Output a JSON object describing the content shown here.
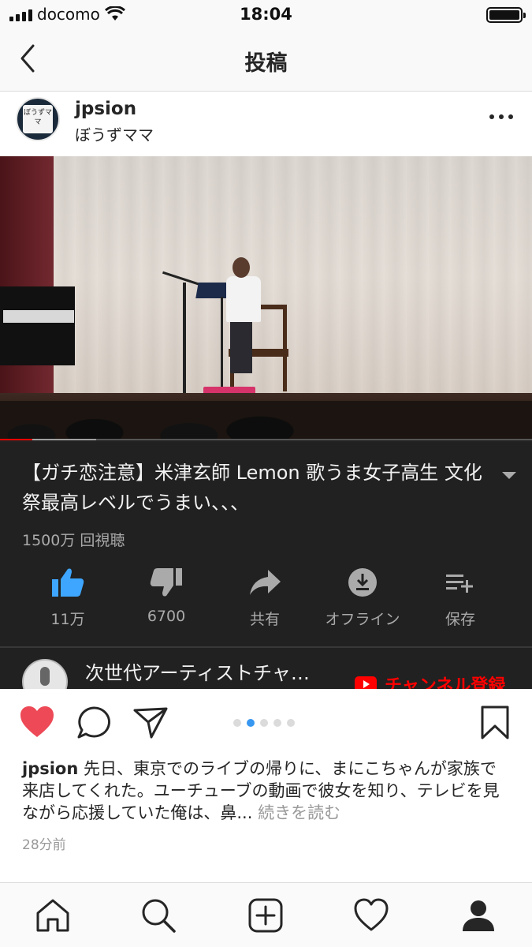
{
  "status_bar": {
    "carrier": "docomo",
    "time": "18:04",
    "battery_level": 1.0
  },
  "nav": {
    "title": "投稿",
    "back_icon": "chevron-left-icon"
  },
  "post": {
    "username": "jpsion",
    "location": "ぼうずママ",
    "avatar_text": "ぼうずママ"
  },
  "video": {
    "title": "【ガチ恋注意】米津玄師 Lemon 歌うま女子高生 文化祭最高レベルでうまい、、、",
    "views": "1500万 回視聴",
    "progress": 0.06,
    "buffered": 0.18,
    "actions": [
      {
        "label": "11万",
        "icon": "thumbs-up-icon"
      },
      {
        "label": "6700",
        "icon": "thumbs-down-icon"
      },
      {
        "label": "共有",
        "icon": "share-icon"
      },
      {
        "label": "オフライン",
        "icon": "download-icon"
      },
      {
        "label": "保存",
        "icon": "playlist-add-icon"
      }
    ],
    "channel_name": "次世代アーティストチャ…",
    "subscribe_label": "チャンネル登録"
  },
  "actions": {
    "liked": true,
    "carousel_count": 5,
    "carousel_active": 1
  },
  "caption": {
    "username": "jpsion",
    "text": " 先日、東京でのライブの帰りに、まにこちゃんが家族で来店してくれた。ユーチューブの動画で彼女を知り、テレビを見ながら応援していた俺は、鼻... ",
    "more_label": "続きを読む",
    "timestamp": "28分前"
  },
  "tab_bar": {
    "items": [
      "home-icon",
      "search-icon",
      "add-post-icon",
      "activity-heart-icon",
      "profile-icon"
    ],
    "active": 4
  },
  "colors": {
    "like_red": "#ed4956",
    "youtube_red": "#ff0000",
    "like_blue": "#3ea6ff",
    "carousel_active": "#3897f0"
  }
}
